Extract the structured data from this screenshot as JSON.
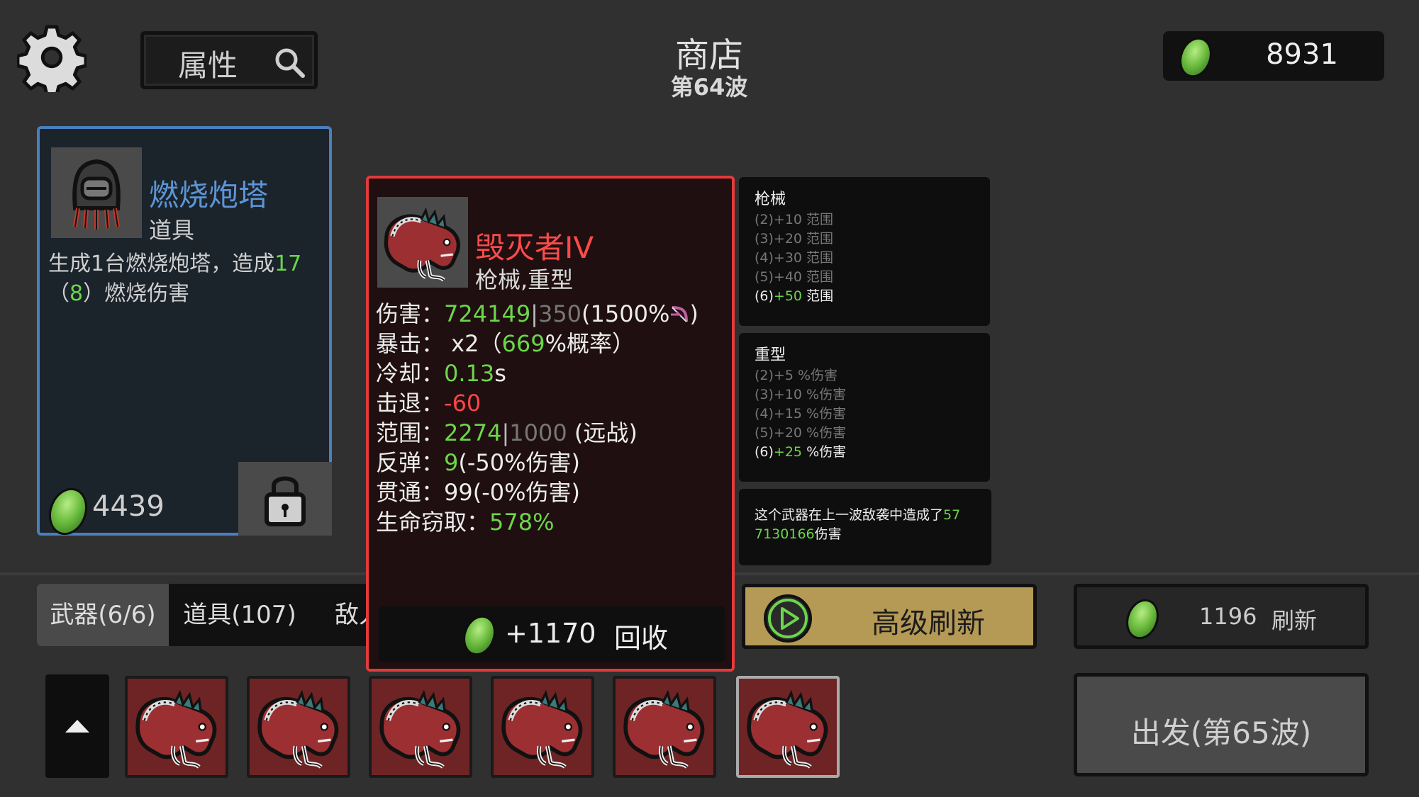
{
  "header": {
    "settings_icon": "gear-icon",
    "search_label": "属性",
    "search_icon": "magnifier-icon",
    "title": "商店",
    "wave": "第64波",
    "currency_icon": "green-gem-icon",
    "currency": "8931"
  },
  "shop_card": {
    "icon": "hooded-turret-icon",
    "name": "燃烧炮塔",
    "type": "道具",
    "desc_1": "生成1台燃烧炮塔，造成",
    "desc_value": "17",
    "desc_2": "（",
    "desc_base": "8",
    "desc_3": "）燃烧伤害",
    "price": "4439",
    "lock_icon": "padlock-icon"
  },
  "weapon_popup": {
    "icon": "dragon-weapon-icon",
    "name": "毁灭者IV",
    "classes": "枪械,重型",
    "stats": [
      {
        "label": "伤害：",
        "v1": "724149",
        "sep": "|",
        "v2": "350",
        "tail": "(1500%",
        "tail_icon": "bow-icon",
        "end": ")"
      },
      {
        "label": "暴击： x2（",
        "v1": "669",
        "tail": "%概率）"
      },
      {
        "label": "冷却：",
        "v1": "0.13",
        "tail": "s"
      },
      {
        "label": "击退：",
        "v1": "-60"
      },
      {
        "label": "范围：",
        "v1": "2274",
        "sep": "|",
        "v2": "1000",
        "tail": " (远战)"
      },
      {
        "label": "反弹：",
        "v1": "9",
        "tail": "(-50%伤害)"
      },
      {
        "label": "贯通：",
        "v1": "99(-0%伤害)"
      },
      {
        "label": "生命窃取：",
        "v1": "578%"
      }
    ],
    "recycle_amount": "+1170",
    "recycle_label": "回收"
  },
  "synergies": [
    {
      "title": "枪械",
      "lines": [
        {
          "text": "(2)+10 范围",
          "active": false
        },
        {
          "text": "(3)+20 范围",
          "active": false
        },
        {
          "text": "(4)+30 范围",
          "active": false
        },
        {
          "text": "(5)+40 范围",
          "active": false
        },
        {
          "pre": "(6)",
          "val": "+50",
          "post": "  范围",
          "active": true
        }
      ]
    },
    {
      "title": "重型",
      "lines": [
        {
          "text": "(2)+5 %伤害",
          "active": false
        },
        {
          "text": "(3)+10 %伤害",
          "active": false
        },
        {
          "text": "(4)+15 %伤害",
          "active": false
        },
        {
          "text": "(5)+20 %伤害",
          "active": false
        },
        {
          "pre": "(6)",
          "val": "+25",
          "post": "  %伤害",
          "active": true
        }
      ]
    }
  ],
  "last_wave": {
    "text_1": "这个武器在上一波敌袭中造成了",
    "v1": "57",
    "v2": "7130166",
    "text_2": "伤害"
  },
  "tabs": [
    {
      "label": "武器(6/6)",
      "active": true
    },
    {
      "label": "道具(107)",
      "active": false
    },
    {
      "label": "敌人",
      "active": false
    }
  ],
  "buttons": {
    "advanced_refresh_icon": "play-icon",
    "advanced_refresh": "高级刷新",
    "refresh_cost": "1196",
    "refresh": "刷新",
    "depart": "出发(第65波)",
    "scroll_up_icon": "up-arrow-icon"
  },
  "inventory": [
    {
      "icon": "dragon-weapon-icon",
      "selected": false
    },
    {
      "icon": "dragon-weapon-icon",
      "selected": false
    },
    {
      "icon": "dragon-weapon-icon",
      "selected": false
    },
    {
      "icon": "dragon-weapon-icon",
      "selected": false
    },
    {
      "icon": "dragon-weapon-icon",
      "selected": false
    },
    {
      "icon": "dragon-weapon-icon",
      "selected": true
    }
  ],
  "colors": {
    "background": "#303030",
    "positive": "#6cd64a",
    "negative": "#ff4545",
    "card_blue": "#4a7fbf",
    "popup_border": "#e23b3b",
    "gold_button": "#b59a55"
  }
}
